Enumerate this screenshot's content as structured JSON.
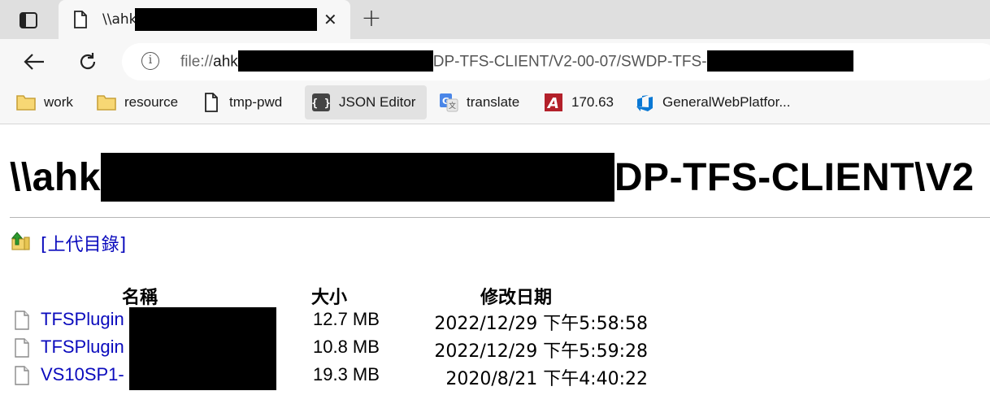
{
  "browser": {
    "tab": {
      "title": "\\\\ahk",
      "close": "✕"
    },
    "new_tab": "+",
    "address": {
      "scheme": "file://",
      "host_visible": "ahk",
      "path_visible": "DP-TFS-CLIENT/V2-00-07/SWDP-TFS-"
    },
    "bookmarks": [
      {
        "label": "work",
        "icon": "folder-icon"
      },
      {
        "label": "resource",
        "icon": "folder-icon"
      },
      {
        "label": "tmp-pwd",
        "icon": "page-icon"
      },
      {
        "label": "JSON Editor",
        "icon": "braces-icon"
      },
      {
        "label": "translate",
        "icon": "google-translate-icon"
      },
      {
        "label": "170.63",
        "icon": "red-a-icon"
      },
      {
        "label": "GeneralWebPlatfor...",
        "icon": "azure-devops-icon"
      }
    ]
  },
  "page": {
    "heading_start": "\\\\ahk",
    "heading_end": "DP-TFS-CLIENT\\V2",
    "parent_link": "[上代目錄]",
    "columns": {
      "name": "名稱",
      "size": "大小",
      "modified": "修改日期"
    },
    "files": [
      {
        "name": "TFSPlugin",
        "size": "12.7 MB",
        "modified": "2022/12/29 下午5:58:58"
      },
      {
        "name": "TFSPlugin",
        "size": "10.8 MB",
        "modified": "2022/12/29 下午5:59:28"
      },
      {
        "name": "VS10SP1-",
        "size": "19.3 MB",
        "modified": "2020/8/21 下午4:40:22"
      }
    ]
  },
  "colors": {
    "link": "#0b0bbd",
    "tabstrip": "#dfdfdf",
    "toolbar": "#f7f7f7"
  }
}
